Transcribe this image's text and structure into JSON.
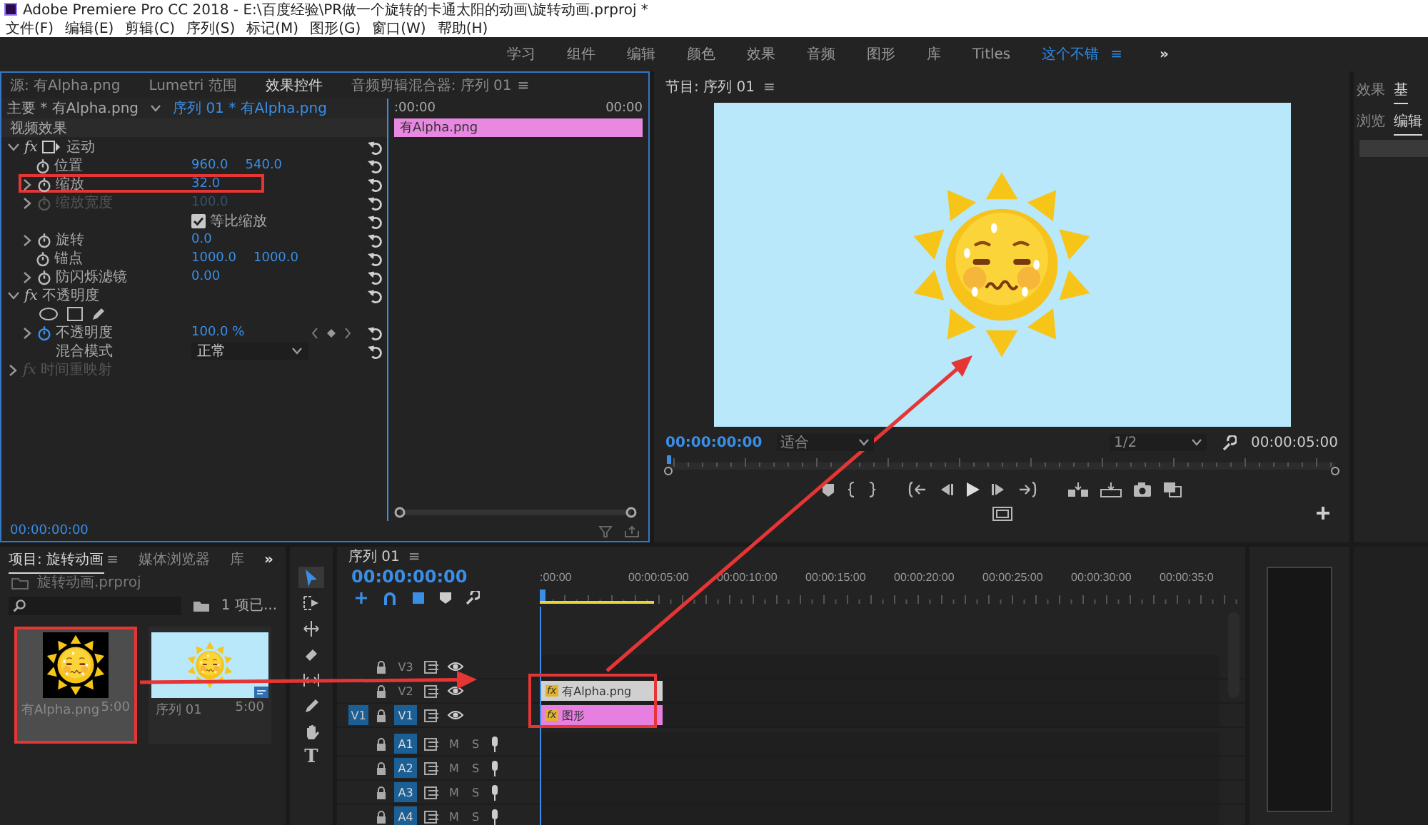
{
  "window": {
    "title": "Adobe Premiere Pro CC 2018 - E:\\百度经验\\PR做一个旋转的卡通太阳的动画\\旋转动画.prproj *"
  },
  "menu": [
    "文件(F)",
    "编辑(E)",
    "剪辑(C)",
    "序列(S)",
    "标记(M)",
    "图形(G)",
    "窗口(W)",
    "帮助(H)"
  ],
  "workspaces": {
    "items": [
      {
        "label": "学习",
        "selected": false
      },
      {
        "label": "组件",
        "selected": false
      },
      {
        "label": "编辑",
        "selected": false
      },
      {
        "label": "颜色",
        "selected": false
      },
      {
        "label": "效果",
        "selected": false
      },
      {
        "label": "音频",
        "selected": false
      },
      {
        "label": "图形",
        "selected": false
      },
      {
        "label": "库",
        "selected": false
      },
      {
        "label": "Titles",
        "selected": false
      },
      {
        "label": "这个不错",
        "selected": true
      }
    ],
    "menu_glyph": "≡",
    "overflow": "»"
  },
  "effect_controls": {
    "tabs": [
      {
        "label": "源: 有Alpha.png",
        "selected": false
      },
      {
        "label": "Lumetri 范围",
        "selected": false
      },
      {
        "label": "效果控件",
        "selected": true
      },
      {
        "label": "音频剪辑混合器: 序列 01",
        "selected": false
      }
    ],
    "menu_glyph": "≡",
    "master": "主要 * 有Alpha.png",
    "sequence": "序列 01 * 有Alpha.png",
    "time_start": ":00:00",
    "time_end": "00:00",
    "section": "视频效果",
    "clip": "有Alpha.png",
    "rows": [
      {
        "kind": "effect",
        "badge": "fx",
        "name": "运动",
        "expanded": true,
        "transform": true,
        "disabled": false
      },
      {
        "kind": "property",
        "name": "位置",
        "values": [
          "960.0",
          "540.0"
        ],
        "expandable": false,
        "highlighted": false,
        "disabled": false,
        "animated": false
      },
      {
        "kind": "property",
        "name": "缩放",
        "values": [
          "32.0"
        ],
        "expandable": true,
        "highlighted": true,
        "disabled": false,
        "animated": false
      },
      {
        "kind": "property",
        "name": "缩放宽度",
        "values": [
          "100.0"
        ],
        "expandable": true,
        "highlighted": false,
        "disabled": true,
        "animated": false
      },
      {
        "kind": "checkbox",
        "name": "等比缩放",
        "checked": true
      },
      {
        "kind": "property",
        "name": "旋转",
        "values": [
          "0.0"
        ],
        "expandable": true,
        "highlighted": false,
        "disabled": false,
        "animated": false
      },
      {
        "kind": "property",
        "name": "锚点",
        "values": [
          "1000.0",
          "1000.0"
        ],
        "expandable": false,
        "highlighted": false,
        "disabled": false,
        "animated": false
      },
      {
        "kind": "property",
        "name": "防闪烁滤镜",
        "values": [
          "0.00"
        ],
        "expandable": true,
        "highlighted": false,
        "disabled": false,
        "animated": false
      },
      {
        "kind": "effect",
        "badge": "fx",
        "name": "不透明度",
        "expanded": true,
        "transform": false,
        "disabled": false
      },
      {
        "kind": "masks"
      },
      {
        "kind": "property",
        "name": "不透明度",
        "values": [
          "100.0 %"
        ],
        "expandable": true,
        "highlighted": false,
        "disabled": false,
        "animated": true
      },
      {
        "kind": "dropdown",
        "name": "混合模式",
        "value": "正常"
      },
      {
        "kind": "effect",
        "badge": "fx",
        "name": "时间重映射",
        "expanded": false,
        "transform": false,
        "disabled": true
      }
    ],
    "timecode": "00:00:00:00"
  },
  "program_monitor": {
    "title": "节目: 序列 01",
    "menu_glyph": "≡",
    "timecode": "00:00:00:00",
    "fit": "适合",
    "resolution": "1/2",
    "duration": "00:00:05:00"
  },
  "side_panel": {
    "tabs": [
      {
        "label": "效果",
        "selected": false
      },
      {
        "label": "基",
        "selected": true
      }
    ],
    "subtabs": [
      {
        "label": "浏览",
        "selected": false
      },
      {
        "label": "编辑",
        "selected": true
      }
    ]
  },
  "project": {
    "tabs": [
      {
        "label": "项目: 旋转动画",
        "selected": true
      },
      {
        "label": "媒体浏览器",
        "selected": false
      },
      {
        "label": "库",
        "selected": false
      }
    ],
    "menu_glyph": "≡",
    "overflow": "»",
    "file": "旋转动画.prproj",
    "count": "1 项已...",
    "items": [
      {
        "kind": "image",
        "name": "有Alpha.png",
        "duration": "5:00",
        "selected": true,
        "highlighted": true
      },
      {
        "kind": "sequence",
        "name": "序列 01",
        "duration": "5:00",
        "selected": false,
        "highlighted": false
      }
    ]
  },
  "tools": [
    {
      "kind": "select",
      "selected": true
    },
    {
      "kind": "track-select",
      "selected": false
    },
    {
      "kind": "ripple",
      "selected": false
    },
    {
      "kind": "razor",
      "selected": false
    },
    {
      "kind": "slip",
      "selected": false
    },
    {
      "kind": "pen",
      "selected": false
    },
    {
      "kind": "hand",
      "selected": false
    },
    {
      "kind": "type",
      "selected": false,
      "glyph": "T"
    }
  ],
  "timeline": {
    "title": "序列 01",
    "menu_glyph": "≡",
    "timecode": "00:00:00:00",
    "ruler": [
      ":00:00",
      "00:00:05:00",
      "00:00:10:00",
      "00:00:15:00",
      "00:00:20:00",
      "00:00:25:00",
      "00:00:30:00",
      "00:00:35:0"
    ],
    "video_tracks": [
      {
        "name": "V3",
        "targeted": false
      },
      {
        "name": "V2",
        "targeted": false,
        "clips": [
          {
            "kind": "image",
            "badge": "fx",
            "label": "有Alpha.png"
          }
        ]
      },
      {
        "name": "V1",
        "targeted": true,
        "source": "V1",
        "clips": [
          {
            "kind": "graphic",
            "badge": "fx",
            "label": "图形"
          }
        ]
      }
    ],
    "audio_tracks": [
      {
        "name": "A1",
        "targeted": true,
        "mute": "M",
        "solo": "S"
      },
      {
        "name": "A2",
        "targeted": true,
        "mute": "M",
        "solo": "S"
      },
      {
        "name": "A3",
        "targeted": true,
        "mute": "M",
        "solo": "S"
      },
      {
        "name": "A4",
        "targeted": true,
        "mute": "M",
        "solo": "S"
      }
    ],
    "clips_highlighted": true
  }
}
